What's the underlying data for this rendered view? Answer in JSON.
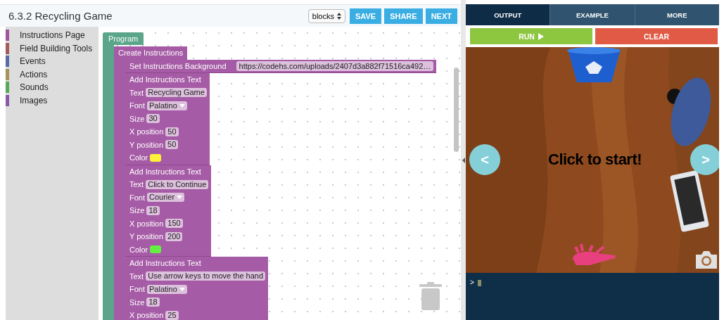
{
  "title": "6.3.2 Recycling Game",
  "mode_select": {
    "value": "blocks"
  },
  "header_buttons": [
    "SAVE",
    "SHARE",
    "NEXT"
  ],
  "categories": [
    {
      "label": "Instructions Page",
      "color": "#a0559d"
    },
    {
      "label": "Field Building Tools",
      "color": "#a85a5a"
    },
    {
      "label": "Events",
      "color": "#5a6aa8"
    },
    {
      "label": "Actions",
      "color": "#a8925a"
    },
    {
      "label": "Sounds",
      "color": "#5aa85a"
    },
    {
      "label": "Images",
      "color": "#8a5aa8"
    }
  ],
  "program": {
    "label": "Program",
    "children": [
      {
        "label": "Create Instructions",
        "statements": [
          {
            "kind": "background",
            "label": "Set Instructions Background",
            "value": "https://codehs.com/uploads/2407d3a882f71516ca492…"
          },
          {
            "kind": "text",
            "title": "Add Instructions Text",
            "fields": [
              {
                "kind": "text",
                "label": "Text",
                "value": "Recycling Game"
              },
              {
                "kind": "dropdown",
                "label": "Font",
                "value": "Palatino"
              },
              {
                "kind": "number",
                "label": "Size",
                "value": "30"
              },
              {
                "kind": "number",
                "label": "X position",
                "value": "50"
              },
              {
                "kind": "number",
                "label": "Y position",
                "value": "50"
              },
              {
                "kind": "color",
                "label": "Color",
                "color": "#fff03a"
              }
            ]
          },
          {
            "kind": "text",
            "title": "Add Instructions Text",
            "fields": [
              {
                "kind": "text",
                "label": "Text",
                "value": "Click to Continue"
              },
              {
                "kind": "dropdown",
                "label": "Font",
                "value": "Courier"
              },
              {
                "kind": "number",
                "label": "Size",
                "value": "18"
              },
              {
                "kind": "number",
                "label": "X position",
                "value": "150"
              },
              {
                "kind": "number",
                "label": "Y position",
                "value": "200"
              },
              {
                "kind": "color",
                "label": "Color",
                "color": "#66ee44"
              }
            ]
          },
          {
            "kind": "text",
            "title": "Add Instructions Text",
            "fields": [
              {
                "kind": "text",
                "label": "Text",
                "value": "Use arrow keys to move the hand"
              },
              {
                "kind": "dropdown",
                "label": "Font",
                "value": "Palatino"
              },
              {
                "kind": "number",
                "label": "Size",
                "value": "18"
              },
              {
                "kind": "number",
                "label": "X position",
                "value": "25"
              }
            ]
          }
        ]
      }
    ]
  },
  "tabs": [
    {
      "label": "OUTPUT",
      "selected": true
    },
    {
      "label": "EXAMPLE",
      "selected": false
    },
    {
      "label": "MORE",
      "selected": false
    }
  ],
  "run_button": "RUN",
  "clear_button": "CLEAR",
  "stage": {
    "message": "Click to start!",
    "nav_buttons": [
      "<",
      ">"
    ]
  },
  "console": {
    "prompt": ">"
  }
}
